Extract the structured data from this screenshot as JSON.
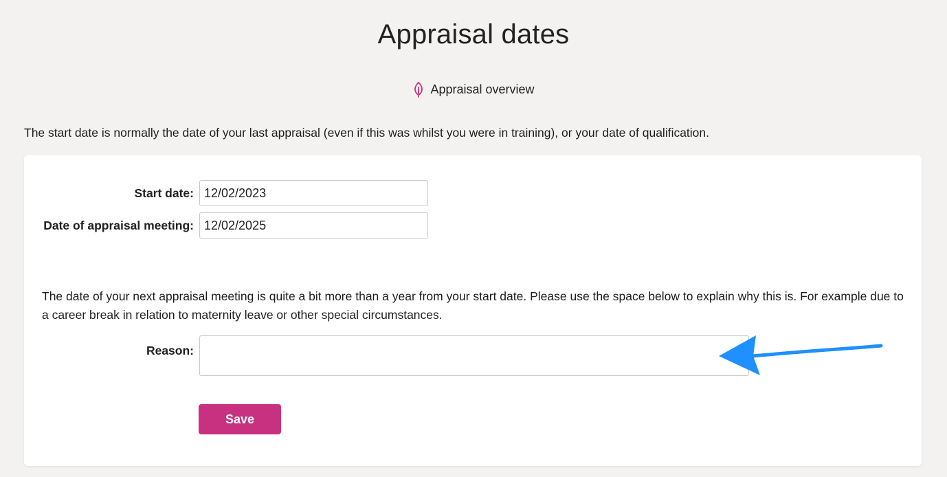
{
  "page": {
    "title": "Appraisal dates",
    "overview_link": "Appraisal overview",
    "overview_icon": "leaf-icon",
    "intro": "The start date is normally the date of your last appraisal (even if this was whilst you were in training), or your date of qualification."
  },
  "form": {
    "start_date_label": "Start date:",
    "start_date_value": "12/02/2023",
    "meeting_date_label": "Date of appraisal meeting:",
    "meeting_date_value": "12/02/2025",
    "explanation": "The date of your next appraisal meeting is quite a bit more than a year from your start date. Please use the space below to explain why this is. For example due to a career break in relation to maternity leave or other special circumstances.",
    "reason_label": "Reason:",
    "reason_value": "",
    "save_label": "Save"
  },
  "colors": {
    "accent": "#c8317f",
    "background": "#f3f2f1",
    "card": "#ffffff",
    "annotation_arrow": "#1e90ff"
  }
}
